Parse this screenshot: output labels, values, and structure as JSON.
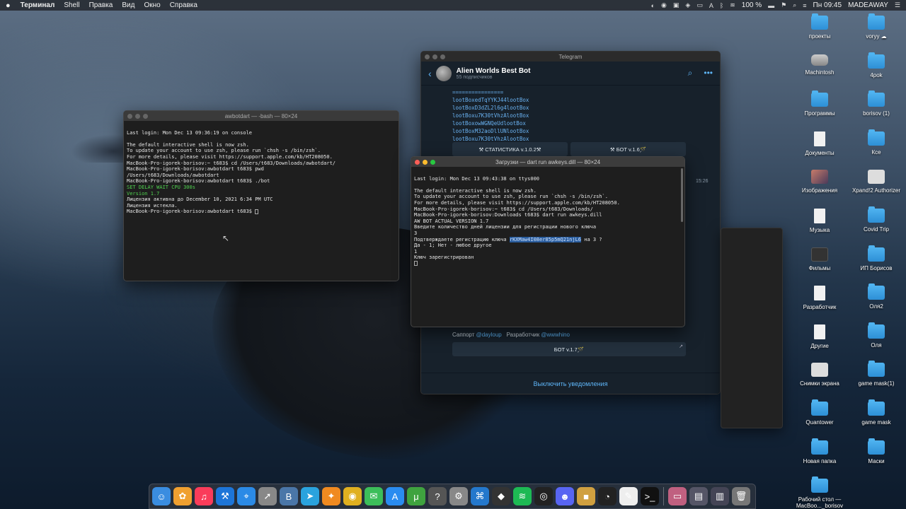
{
  "menubar": {
    "app_name": "Терминал",
    "items": [
      "Shell",
      "Правка",
      "Вид",
      "Окно",
      "Справка"
    ],
    "battery": "100 %",
    "clock": "Пн 09:45",
    "user": "MADEAWAY",
    "tray_icons": [
      "steam-icon",
      "record-icon",
      "image-capture-icon",
      "adobe-icon",
      "display-icon",
      "keyboard-layout-icon",
      "bluetooth-icon",
      "wifi-icon",
      "battery-icon"
    ]
  },
  "terminal1": {
    "title": "awbotdart — -bash — 80×24",
    "lines": [
      "Last login: Mon Dec 13 09:36:19 on console",
      "",
      "The default interactive shell is now zsh.",
      "To update your account to use zsh, please run `chsh -s /bin/zsh`.",
      "For more details, please visit https://support.apple.com/kb/HT208050.",
      "MacBook-Pro-igorek-borisov:~ t683$ cd /Users/t683/Downloads/awbotdart/",
      "MacBook-Pro-igorek-borisov:awbotdart t683$ pwd",
      "/Users/t683/Downloads/awbotdart",
      "MacBook-Pro-igorek-borisov:awbotdart t683$ ./bot"
    ],
    "green_lines": [
      "SET DELAY WAIT CPU 300s",
      "Version 1.7"
    ],
    "tail_lines": [
      "Лицензия активна до December 10, 2021 6:34 PM UTC",
      "Лицензия истекла.",
      "MacBook-Pro-igorek-borisov:awbotdart t683$ "
    ]
  },
  "terminal2": {
    "title": "Загрузки — dart run awkeys.dill — 80×24",
    "lines_before": [
      "Last login: Mon Dec 13 09:43:38 on ttys000",
      "",
      "The default interactive shell is now zsh.",
      "To update your account to use zsh, please run `chsh -s /bin/zsh`.",
      "For more details, please visit https://support.apple.com/kb/HT208050.",
      "MacBook-Pro-igorek-borisov:~ t683$ cd /Users/t683/Downloads/",
      "MacBook-Pro-igorek-borisov:Downloads t683$ dart run awkeys.dill",
      "AW BOT ACTUAL VERSION 1.7",
      "Введите количество дней лицензии для регистрации нового ключа",
      "3"
    ],
    "confirm_prefix": "Подтверждаете регистрацию ключа ",
    "key_highlight": "rKXMaw4I08er85p5mQ21njL6",
    "confirm_suffix": " на 3 ?",
    "lines_after": [
      "Да - 1; Нет - любое другое",
      "1",
      "Ключ зарегистрирован"
    ]
  },
  "telegram": {
    "window_title": "Telegram",
    "channel_name": "Alien Worlds Best Bot",
    "subscribers": "55 подписчиков",
    "separator": "================",
    "loot_lines": [
      "lootBoxedTqYYKJ44lootBox",
      "lootBoxD3dZL2l6g4lootBox",
      "lootBoxu7K30tVhzAlootBox",
      "lootBoxowWGNQeUdlootBox",
      "lootBoxM32aoDllUNlootBox",
      "lootBoxu7K30tVhzAlootBox"
    ],
    "btn_stats": "⚒ СТАТИСТИКА v.1.0.2⚒",
    "btn_bot_top": "⚒ БОТ v.1.6🪄",
    "time": "15:26",
    "support_label": "Саппорт",
    "support_handle": "@dayloup",
    "dev_label": "Разработчик",
    "dev_handle": "@wwwhino",
    "btn_bot_bottom": "БОТ v.1.7🪄",
    "mute_label": "Выключить уведомления"
  },
  "desktop_icons": [
    {
      "label": "проекты",
      "kind": "folder"
    },
    {
      "label": "voryy ☁",
      "kind": "folder"
    },
    {
      "label": "Machintosh",
      "kind": "drive"
    },
    {
      "label": "4pok",
      "kind": "folder"
    },
    {
      "label": "Программы",
      "kind": "folder"
    },
    {
      "label": "borisov (1)",
      "kind": "folder"
    },
    {
      "label": "Документы",
      "kind": "doc"
    },
    {
      "label": "Ксе",
      "kind": "folder"
    },
    {
      "label": "Изображения",
      "kind": "img"
    },
    {
      "label": "Xpand!2 Authorizer",
      "kind": "app"
    },
    {
      "label": "Музыка",
      "kind": "doc"
    },
    {
      "label": "Covid Trip",
      "kind": "folder"
    },
    {
      "label": "Фильмы",
      "kind": "dark"
    },
    {
      "label": "ИП Борисов",
      "kind": "folder"
    },
    {
      "label": "Разработчик",
      "kind": "doc"
    },
    {
      "label": "Оля2",
      "kind": "folder"
    },
    {
      "label": "Другие",
      "kind": "doc"
    },
    {
      "label": "Оля",
      "kind": "folder"
    },
    {
      "label": "Снимки экрана",
      "kind": "app"
    },
    {
      "label": "game mask(1)",
      "kind": "folder"
    },
    {
      "label": "Quantower",
      "kind": "folder"
    },
    {
      "label": "game mask",
      "kind": "folder"
    },
    {
      "label": "Новая папка",
      "kind": "folder"
    },
    {
      "label": "Маски",
      "kind": "folder"
    },
    {
      "label": "Рабочий стол — MacBoo..._borisov",
      "kind": "folder"
    }
  ],
  "dock": [
    {
      "name": "finder-icon",
      "glyph": "☺",
      "color": "#3a8de0"
    },
    {
      "name": "photos-icon",
      "glyph": "✿",
      "color": "#f0a030"
    },
    {
      "name": "music-icon",
      "glyph": "♫",
      "color": "#fa3c5a"
    },
    {
      "name": "xcode-icon",
      "glyph": "⚒",
      "color": "#1d75d8"
    },
    {
      "name": "safari-icon",
      "glyph": "⌖",
      "color": "#2b8ae6"
    },
    {
      "name": "launchpad-icon",
      "glyph": "➚",
      "color": "#888"
    },
    {
      "name": "vk-icon",
      "glyph": "В",
      "color": "#4a76a8"
    },
    {
      "name": "telegram-icon",
      "glyph": "➤",
      "color": "#2aa3de"
    },
    {
      "name": "fl-studio-icon",
      "glyph": "✦",
      "color": "#f08a20"
    },
    {
      "name": "chrome-icon",
      "glyph": "◉",
      "color": "#e0b020"
    },
    {
      "name": "messages-icon",
      "glyph": "✉",
      "color": "#3cbe5a"
    },
    {
      "name": "appstore-icon",
      "glyph": "A",
      "color": "#2a8cf0"
    },
    {
      "name": "torrent-icon",
      "glyph": "μ",
      "color": "#3fa33f"
    },
    {
      "name": "help-icon",
      "glyph": "?",
      "color": "#555"
    },
    {
      "name": "system-preferences-icon",
      "glyph": "⚙",
      "color": "#888"
    },
    {
      "name": "vscode-icon",
      "glyph": "⌘",
      "color": "#2478cc"
    },
    {
      "name": "unity-icon",
      "glyph": "◆",
      "color": "#333"
    },
    {
      "name": "spotify-icon",
      "glyph": "≋",
      "color": "#1db954"
    },
    {
      "name": "obs-icon",
      "glyph": "◎",
      "color": "#222"
    },
    {
      "name": "discord-icon",
      "glyph": "☻",
      "color": "#5865f2"
    },
    {
      "name": "app-badge-icon",
      "glyph": "■",
      "color": "#d0a040"
    },
    {
      "name": "speedtest-icon",
      "glyph": "◔",
      "color": "#222"
    },
    {
      "name": "textedit-icon",
      "glyph": "✎",
      "color": "#eee"
    },
    {
      "name": "terminal-icon",
      "glyph": ">_",
      "color": "#111"
    },
    {
      "name": "preview-icon",
      "glyph": "▭",
      "color": "#c06080"
    },
    {
      "name": "window-thumb-icon",
      "glyph": "▤",
      "color": "#556"
    },
    {
      "name": "window-thumb2-icon",
      "glyph": "▥",
      "color": "#445"
    },
    {
      "name": "trash-icon",
      "glyph": "🗑",
      "color": "#777"
    }
  ]
}
